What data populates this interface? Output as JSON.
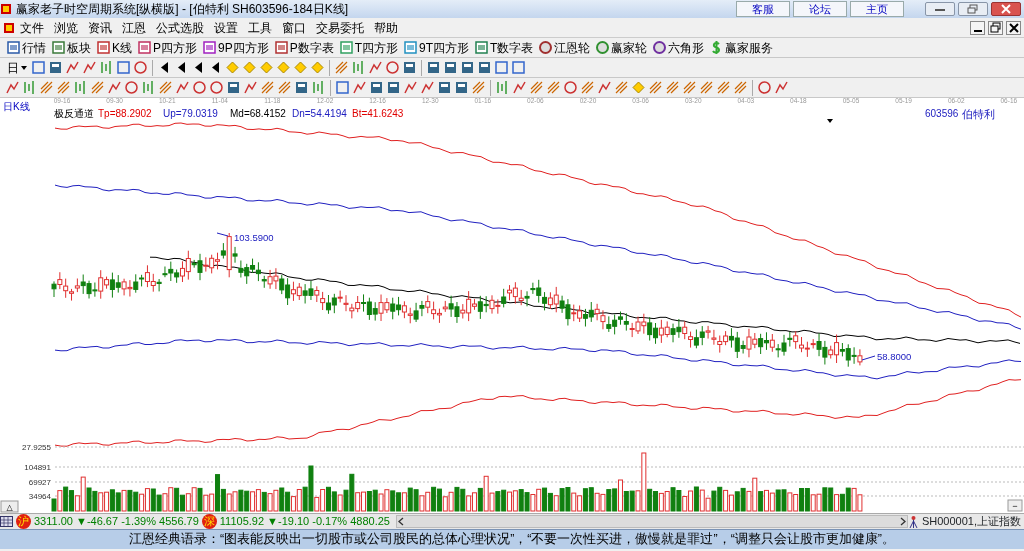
{
  "window": {
    "title": "赢家老子时空周期系统[纵横版] - [伯特利  SH603596-184日K线]",
    "links": [
      "客服",
      "论坛",
      "主页"
    ]
  },
  "menu": [
    "文件",
    "浏览",
    "资讯",
    "江恩",
    "公式选股",
    "设置",
    "工具",
    "窗口",
    "交易委托",
    "帮助"
  ],
  "toolbar": [
    "行情",
    "板块",
    "K线",
    "P四方形",
    "9P四方形",
    "P数字表",
    "T四方形",
    "9T四方形",
    "T数字表",
    "江恩轮",
    "赢家轮",
    "六角形",
    "赢家服务"
  ],
  "period_dropdown": "日",
  "chart": {
    "period": "日K线",
    "dates": [
      "09-16",
      "09-30",
      "10-21",
      "11-04",
      "11-18",
      "12-02",
      "12-16",
      "12-30",
      "01-16",
      "02-06",
      "02-20",
      "03-06",
      "03-20",
      "04-03",
      "04-18",
      "05-05",
      "05-19",
      "06-02",
      "06-16"
    ],
    "indicator_name": "极反通道",
    "indicator_values": [
      {
        "text": "Tp=88.2902",
        "color": "#e00000"
      },
      {
        "text": "Up=79.0319",
        "color": "#2020c0"
      },
      {
        "text": "Md=68.4152",
        "color": "#000000"
      },
      {
        "text": "Dn=54.4194",
        "color": "#2020c0"
      },
      {
        "text": "Bt=41.6243",
        "color": "#e00000"
      }
    ],
    "code": "603596",
    "stock_name": "伯特利",
    "high_label": "103.5900",
    "low_label": "58.8000",
    "axis_label": "27.9255",
    "volume_ticks": [
      "104891",
      "69927",
      "34964"
    ],
    "panel_toggle": "△",
    "panel_minimize": "−"
  },
  "status_bar": {
    "indices": [
      {
        "badge": "沪",
        "text": "3311.00 ▼-46.67 -1.39% 4556.79"
      },
      {
        "badge": "深",
        "text": "11105.92 ▼-19.10 -0.17% 4880.25"
      }
    ],
    "current": "SH000001,上证指数"
  },
  "quote": "江恩经典语录：“图表能反映出一切股市或公司股民的总体心理状况”，“不要一次性买进，傲慢就是罪过”，“调整只会让股市更加健康”。"
}
